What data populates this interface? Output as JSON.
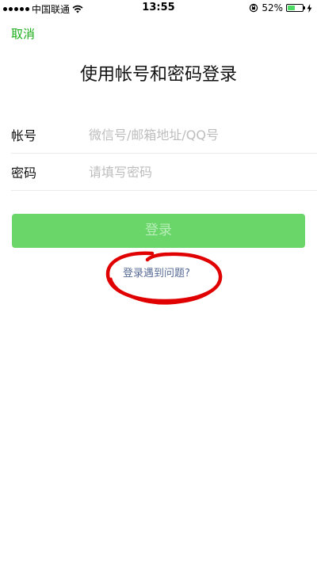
{
  "status_bar": {
    "carrier": "中国联通",
    "time": "13:55",
    "battery_percent": "52%",
    "battery_level": 0.52
  },
  "nav": {
    "cancel_label": "取消"
  },
  "title": "使用帐号和密码登录",
  "form": {
    "account_label": "帐号",
    "account_placeholder": "微信号/邮箱地址/QQ号",
    "password_label": "密码",
    "password_placeholder": "请填写密码"
  },
  "login_button_label": "登录",
  "help_link": "登录遇到问题?",
  "colors": {
    "accent_green": "#1aad19",
    "button_green": "#6ad66a",
    "link_blue": "#576b95",
    "annotation_red": "#e00000"
  }
}
